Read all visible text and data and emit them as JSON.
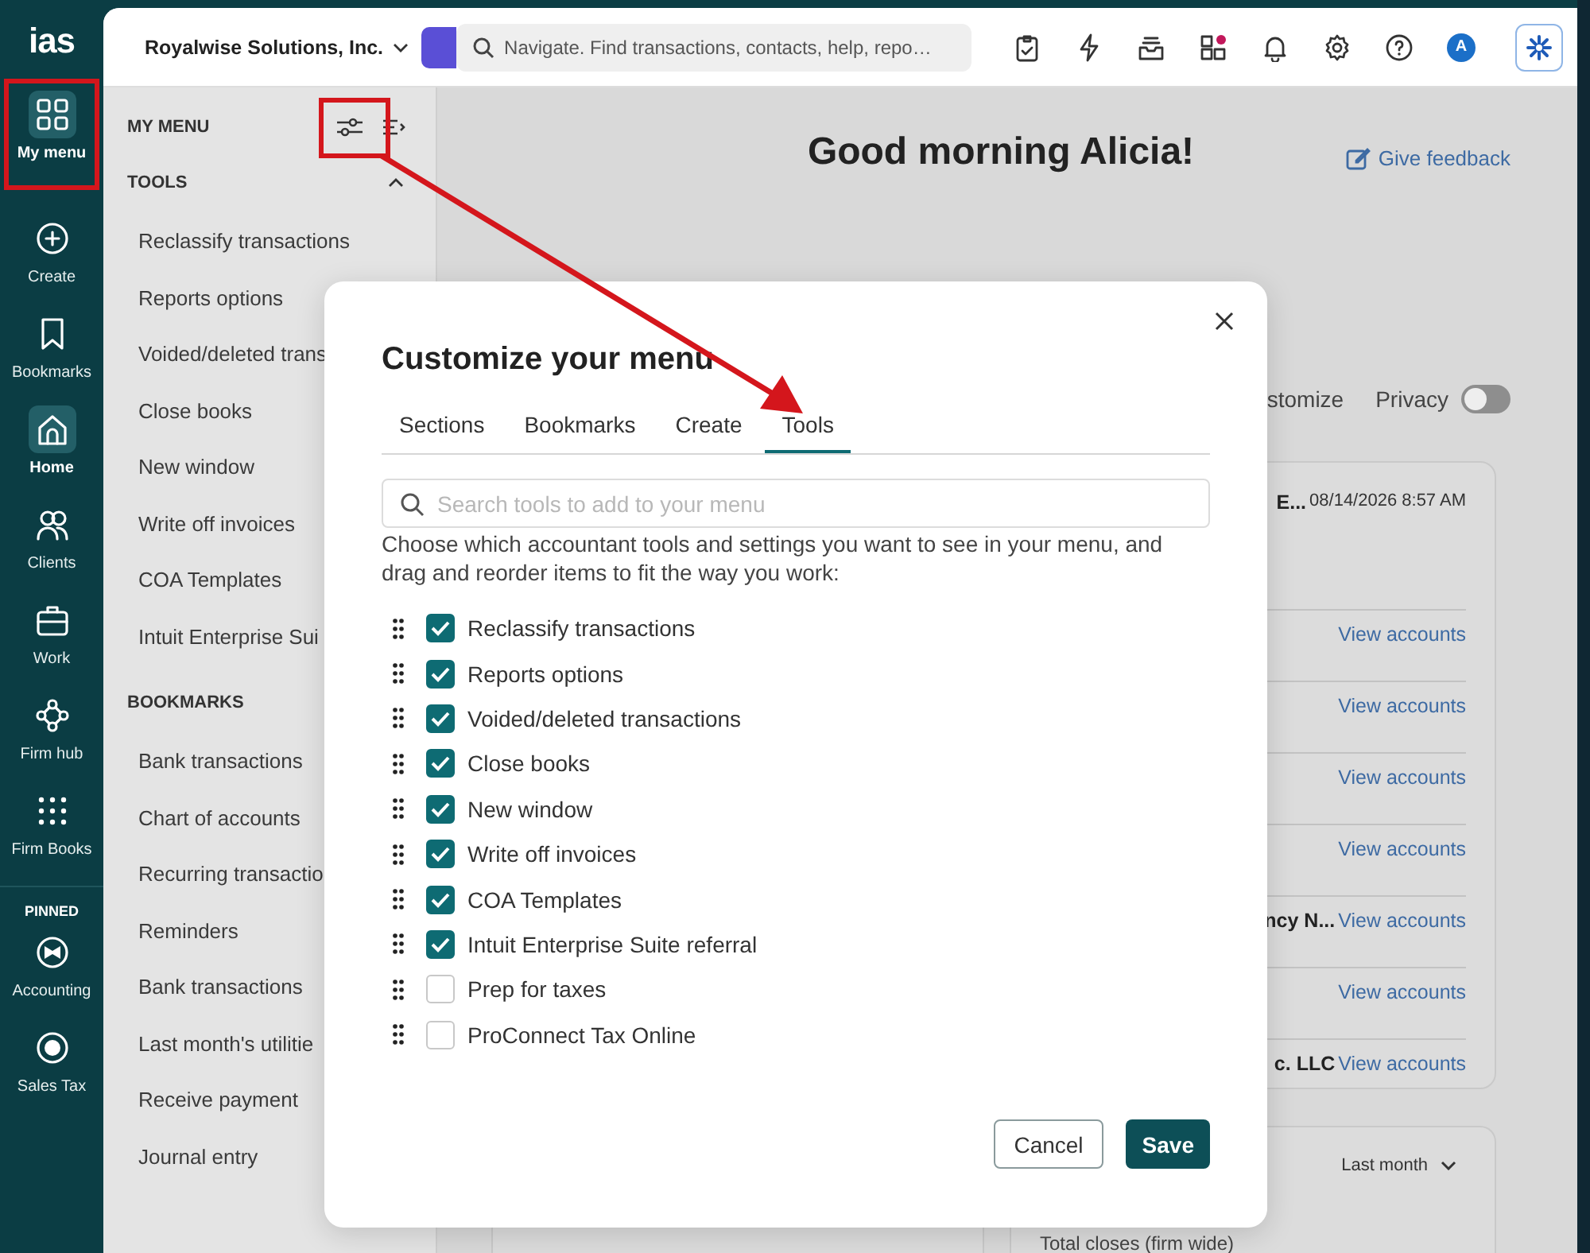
{
  "rail": {
    "logo": "ias",
    "items": [
      {
        "label": "My menu",
        "selected": true
      },
      {
        "label": "Create",
        "selected": false
      },
      {
        "label": "Bookmarks",
        "selected": false
      },
      {
        "label": "Home",
        "selected": true
      },
      {
        "label": "Clients",
        "selected": false
      },
      {
        "label": "Work",
        "selected": false
      },
      {
        "label": "Firm hub",
        "selected": false
      },
      {
        "label": "Firm Books",
        "selected": false
      }
    ],
    "pinned_label": "PINNED",
    "pinned": [
      {
        "label": "Accounting",
        "selected": false
      },
      {
        "label": "Sales Tax",
        "selected": false
      }
    ]
  },
  "header": {
    "company": "Royalwise Solutions, Inc.",
    "search": {
      "placeholder": "Navigate. Find transactions, contacts, help, repo…"
    },
    "avatar": "A"
  },
  "sidebar": {
    "title": "MY MENU",
    "sections": [
      {
        "title": "TOOLS",
        "expanded": true,
        "items": [
          "Reclassify transactions",
          "Reports options",
          "Voided/deleted trans",
          "Close books",
          "New window",
          "Write off invoices",
          "COA Templates",
          "Intuit Enterprise Sui"
        ]
      },
      {
        "title": "BOOKMARKS",
        "items": [
          "Bank transactions",
          "Chart of accounts",
          "Recurring transactio",
          "Reminders",
          "Bank transactions",
          "Last month's utilitie",
          "Receive payment",
          "Journal entry"
        ]
      }
    ]
  },
  "main": {
    "greeting": "Good morning Alicia!",
    "feedback": "Give feedback",
    "customize": "stomize",
    "privacy": {
      "label": "Privacy",
      "on": false
    },
    "activity_rows": [
      {
        "name": "E...",
        "time": "08/14/2026 8:57 AM"
      },
      {
        "link": "View accounts"
      },
      {
        "link": "View accounts"
      },
      {
        "link": "View accounts"
      },
      {
        "link": "View accounts"
      },
      {
        "name": "ncy N...",
        "link": "View accounts"
      },
      {
        "link": "View accounts"
      },
      {
        "name": "c. LLC",
        "link": "View accounts"
      }
    ],
    "closes_card": {
      "period": "Last month",
      "subtitle": "Total closes (firm wide)"
    }
  },
  "modal": {
    "title": "Customize your menu",
    "tabs": [
      {
        "label": "Sections",
        "selected": false
      },
      {
        "label": "Bookmarks",
        "selected": false
      },
      {
        "label": "Create",
        "selected": false
      },
      {
        "label": "Tools",
        "selected": true
      }
    ],
    "search": {
      "placeholder": "Search tools to add to your menu"
    },
    "description": "Choose which accountant tools and settings you want to see in your menu, and drag and reorder items to fit the way you work:",
    "items": [
      {
        "label": "Reclassify transactions",
        "checked": true
      },
      {
        "label": "Reports options",
        "checked": true
      },
      {
        "label": "Voided/deleted transactions",
        "checked": true
      },
      {
        "label": "Close books",
        "checked": true
      },
      {
        "label": "New window",
        "checked": true
      },
      {
        "label": "Write off invoices",
        "checked": true
      },
      {
        "label": "COA Templates",
        "checked": true
      },
      {
        "label": "Intuit Enterprise Suite referral",
        "checked": true
      },
      {
        "label": "Prep for taxes",
        "checked": false
      },
      {
        "label": "ProConnect Tax Online",
        "checked": false
      }
    ],
    "buttons": {
      "cancel": "Cancel",
      "save": "Save"
    }
  }
}
